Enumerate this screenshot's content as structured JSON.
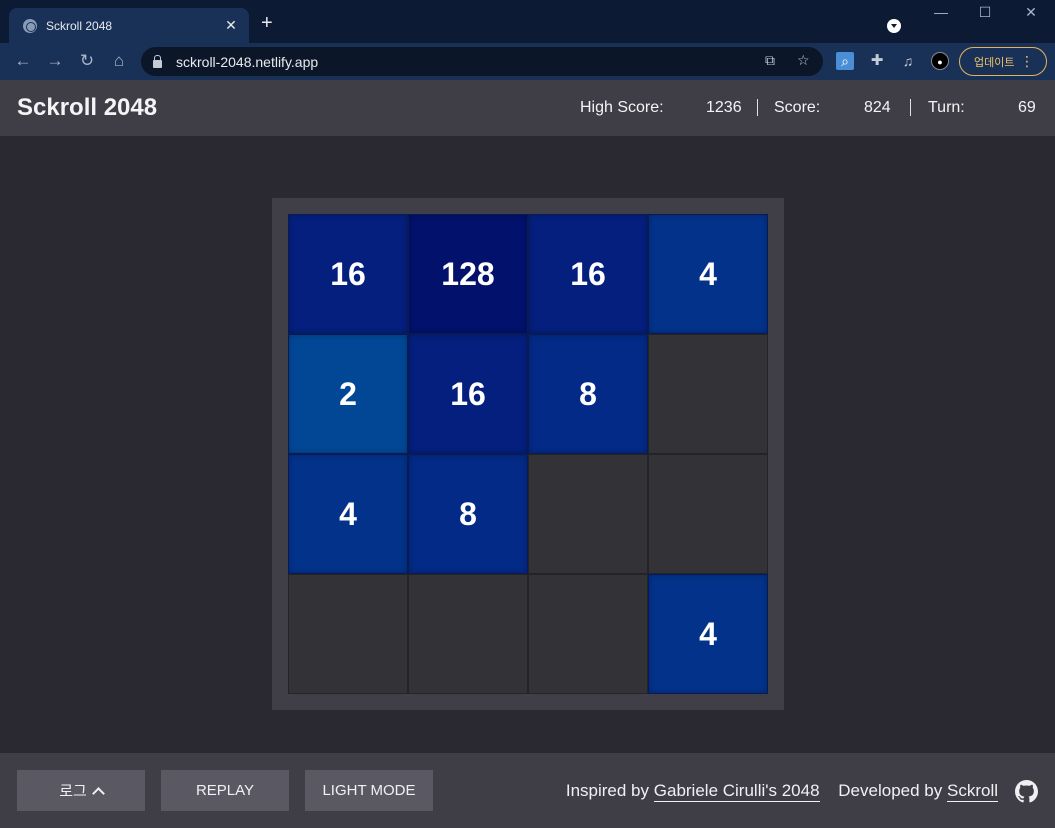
{
  "browser": {
    "tab_title": "Sckroll 2048",
    "tab_close": "✕",
    "new_tab": "+",
    "url": "sckroll-2048.netlify.app",
    "update_label": "업데이트",
    "update_menu": "⋮",
    "window_controls": {
      "minimize": "—",
      "maximize": "☐",
      "close": "✕"
    },
    "nav": {
      "back": "←",
      "forward": "→",
      "reload": "↻",
      "home": "⌂"
    },
    "icons": [
      "translate-icon",
      "star-icon",
      "search-extension-icon",
      "puzzle-icon",
      "media-icon",
      "profile-icon"
    ]
  },
  "header": {
    "title": "Sckroll 2048",
    "high_score_label": "High Score:",
    "high_score_value": "1236",
    "score_label": "Score:",
    "score_value": "824",
    "turn_label": "Turn:",
    "turn_value": "69"
  },
  "board": {
    "cells": [
      "16",
      "128",
      "16",
      "4",
      "2",
      "16",
      "8",
      "",
      "4",
      "8",
      "",
      "",
      "",
      "",
      "",
      "4"
    ]
  },
  "footer": {
    "log_button": "로그",
    "replay_button": "REPLAY",
    "light_mode_button": "LIGHT MODE",
    "inspired_prefix": "Inspired by",
    "inspired_link": "Gabriele Cirulli's 2048",
    "developed_prefix": "Developed by",
    "developed_link": "Sckroll"
  },
  "colors": {
    "background": "#2a2931",
    "header": "#3f3e47",
    "board_frame": "#403f47",
    "empty_cell": "#333236",
    "tile_2": "#024795",
    "tile_4": "#03328a",
    "tile_8": "#032a86",
    "tile_16": "#041f7e",
    "tile_128": "#02116b",
    "button": "#5a5963"
  }
}
